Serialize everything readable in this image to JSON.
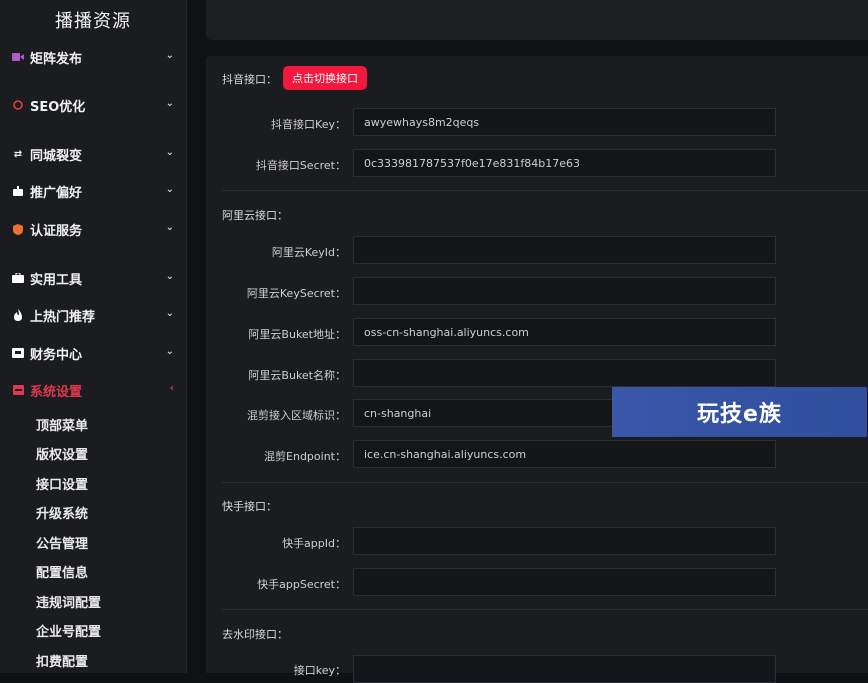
{
  "sidebar": {
    "brand": "播播资源",
    "items": [
      {
        "label": "矩阵发布",
        "icon": "video-icon",
        "color": "#b05cc8"
      },
      {
        "label": "SEO优化",
        "icon": "seo-icon",
        "color": "#e04040"
      },
      {
        "label": "同城裂变",
        "icon": "link-icon",
        "color": "#ffffff"
      },
      {
        "label": "推广偏好",
        "icon": "robot-icon",
        "color": "#ffffff"
      },
      {
        "label": "认证服务",
        "icon": "shield-icon",
        "color": "#f07030"
      },
      {
        "label": "实用工具",
        "icon": "toolbox-icon",
        "color": "#ffffff"
      },
      {
        "label": "上热门推荐",
        "icon": "fire-icon",
        "color": "#ffffff"
      },
      {
        "label": "财务中心",
        "icon": "wallet-icon",
        "color": "#ffffff"
      },
      {
        "label": "系统设置",
        "icon": "settings-icon",
        "color": "#e0384f"
      }
    ],
    "sub_items": [
      "顶部菜单",
      "版权设置",
      "接口设置",
      "升级系统",
      "公告管理",
      "配置信息",
      "违规词配置",
      "企业号配置",
      "扣费配置"
    ]
  },
  "douyin": {
    "title": "抖音接口：",
    "switch_button": "点击切换接口",
    "key_label": "抖音接口Key：",
    "key_value": "awyewhays8m2qeqs",
    "secret_label": "抖音接口Secret：",
    "secret_value": "0c333981787537f0e17e831f84b17e63"
  },
  "aliyun": {
    "title": "阿里云接口：",
    "keyid_label": "阿里云KeyId：",
    "keyid_value": "",
    "keysecret_label": "阿里云KeySecret：",
    "keysecret_value": "",
    "buket_addr_label": "阿里云Buket地址：",
    "buket_addr_value": "oss-cn-shanghai.aliyuncs.com",
    "buket_name_label": "阿里云Buket名称：",
    "buket_name_value": "",
    "region_label": "混剪接入区域标识：",
    "region_value": "cn-shanghai",
    "endpoint_label": "混剪Endpoint：",
    "endpoint_value": "ice.cn-shanghai.aliyuncs.com"
  },
  "kuaishou": {
    "title": "快手接口：",
    "appid_label": "快手appId：",
    "appid_value": "",
    "appsecret_label": "快手appSecret：",
    "appsecret_value": ""
  },
  "watermark_api": {
    "title": "去水印接口：",
    "key_label": "接口key："
  },
  "watermark_logo": "玩技e族"
}
